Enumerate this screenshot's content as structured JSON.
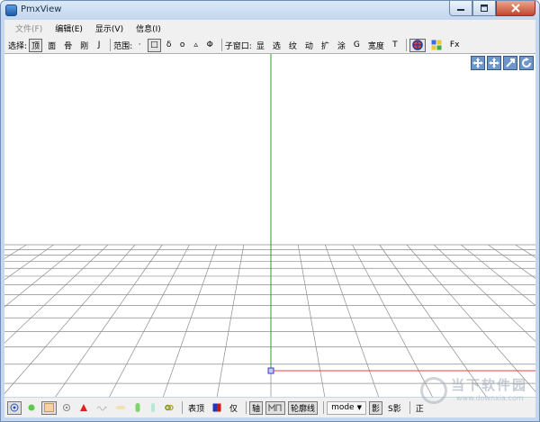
{
  "window": {
    "title": "PmxView"
  },
  "menu": [
    "文件(F)",
    "编辑(E)",
    "显示(V)",
    "信息(I)"
  ],
  "toolbar": {
    "select_label": "选择:",
    "select_items": [
      "顶",
      "面",
      "骨",
      "刚",
      "J"
    ],
    "range_label": "范围:",
    "range_items": [
      "·",
      "□",
      "δ",
      "o",
      "▵",
      "Φ"
    ],
    "sub_label": "子窗口:",
    "sub_items": [
      "显",
      "选",
      "纹",
      "动",
      "扩",
      "涂",
      "G",
      "宽度",
      "T"
    ],
    "fx": "Fx"
  },
  "statusbar": {
    "front_label": "表顶",
    "only_label": "仅",
    "axis_label": "轴",
    "outline_label": "轮廓线",
    "mode_label": "mode",
    "shadow_label": "影",
    "sshadow_label": "S影",
    "ortho_label": "正"
  },
  "watermark": {
    "text": "当下软件园",
    "url": "www.downxia.com"
  },
  "colors": {
    "axis_green": "#2f9e2f",
    "axis_red": "#ee3b3b",
    "grid": "#8c8c8c",
    "chrome": "#f0f0f0"
  }
}
